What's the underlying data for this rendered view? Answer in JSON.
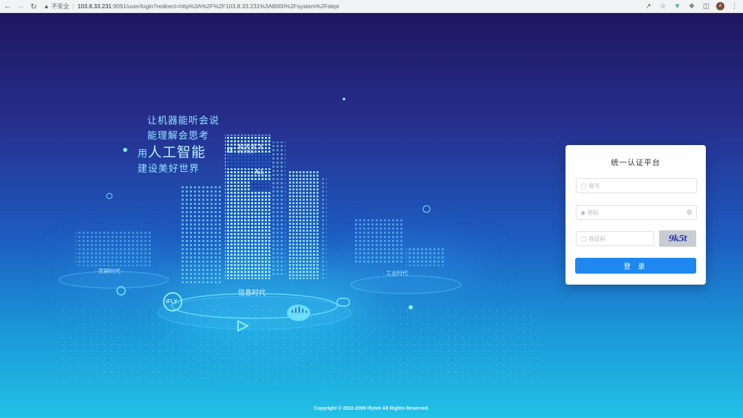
{
  "browser": {
    "insecure_label": "不安全",
    "url_host": "103.8.33.231",
    "url_rest": ":9091/user/login?redirect=http%3A%2F%2F103.8.33.231%3A8000%2Fsystem%2Fdept",
    "profile_initial": "A"
  },
  "hero": {
    "slogan_line1": "让机器能听会说",
    "slogan_line2": "能理解会思考",
    "slogan_line3_prefix": "用",
    "slogan_line3_highlight": "人工智能",
    "slogan_line4": "建设美好世界",
    "brand_cn": "科大讯飞",
    "brand_en": "iFLYTEK",
    "ai_badge": "A.I.",
    "era_left": "· 农耕时代 ·",
    "era_center": "信息时代",
    "era_right": "· 工业时代 ·",
    "ifly_badge": "iFLY"
  },
  "login": {
    "title": "统一认证平台",
    "username_placeholder": "账号",
    "password_placeholder": "密码",
    "captcha_placeholder": "验证码",
    "captcha_text": "9k5t",
    "submit_label": "登 录"
  },
  "footer": {
    "copyright": "Copyright © 2022-2099 iflytek All Rights Reserved."
  },
  "colors": {
    "primary_button": "#1e88f0",
    "bg_top": "#1f1660",
    "bg_bottom": "#22c1e6"
  }
}
